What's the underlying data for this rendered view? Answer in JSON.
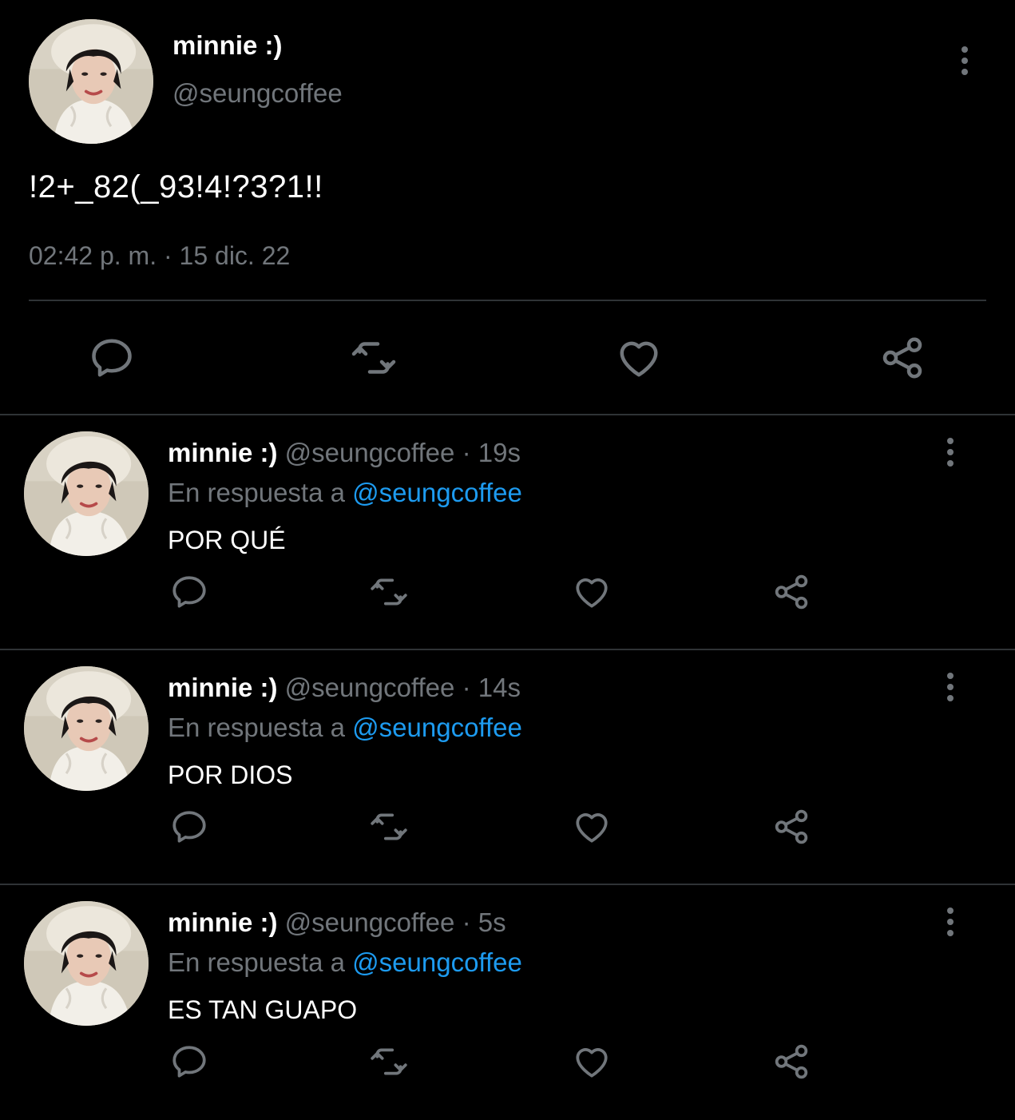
{
  "main_tweet": {
    "name": "minnie :)",
    "handle": "@seungcoffee",
    "text": "!2+_82(_93!4!?3?1!!",
    "time": "02:42 p. m.",
    "separator": "·",
    "date": "15 dic. 22",
    "actions": [
      "reply-icon",
      "retweet-icon",
      "like-icon",
      "share-icon"
    ]
  },
  "replies": [
    {
      "name": "minnie :)",
      "handle": "@seungcoffee",
      "separator": "·",
      "time": "19s",
      "in_reply_prefix": "En respuesta a",
      "in_reply_mention": "@seungcoffee",
      "text": "POR QUÉ"
    },
    {
      "name": "minnie :)",
      "handle": "@seungcoffee",
      "separator": "·",
      "time": "14s",
      "in_reply_prefix": "En respuesta a",
      "in_reply_mention": "@seungcoffee",
      "text": "POR DIOS"
    },
    {
      "name": "minnie :)",
      "handle": "@seungcoffee",
      "separator": "·",
      "time": "5s",
      "in_reply_prefix": "En respuesta a",
      "in_reply_mention": "@seungcoffee",
      "text": "ES TAN GUAPO"
    }
  ],
  "colors": {
    "background": "#000000",
    "text": "#ffffff",
    "muted": "#71767b",
    "mention": "#1d9bf0",
    "divider": "#2f3336"
  }
}
